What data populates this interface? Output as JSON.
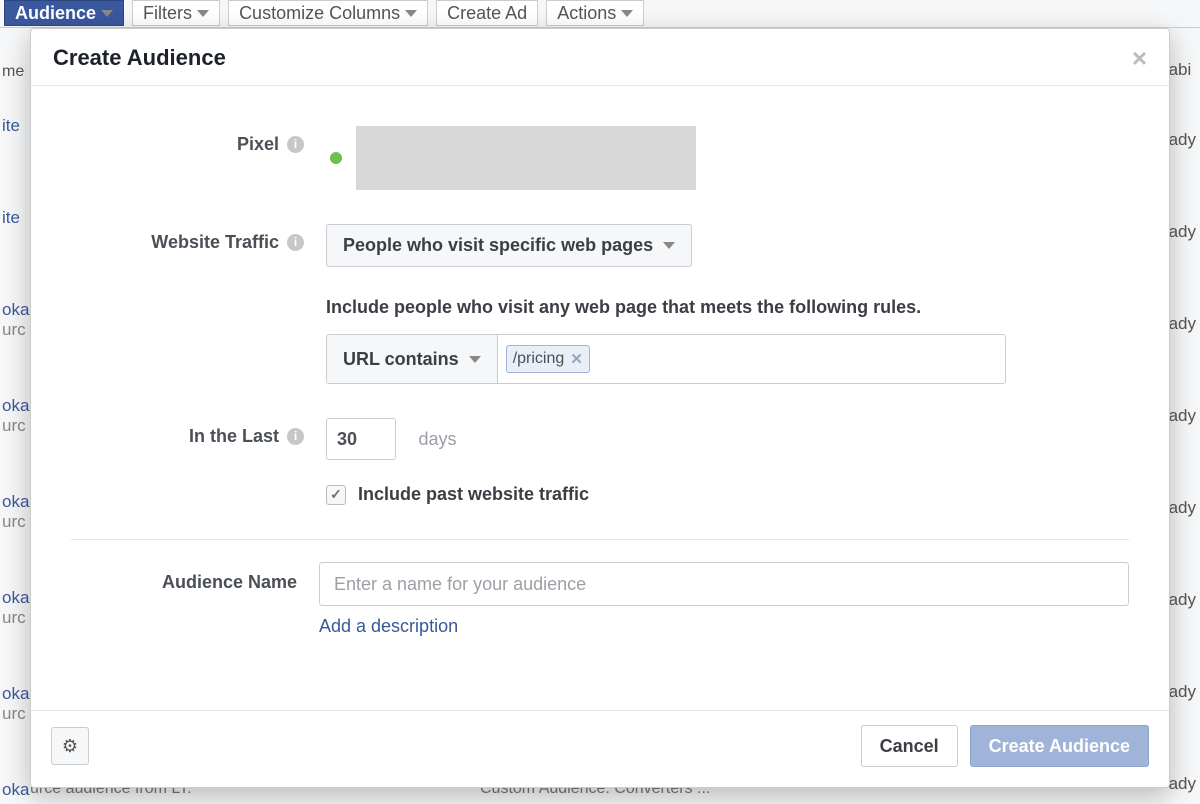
{
  "bg": {
    "audience_btn": "Audience",
    "filters_btn": "Filters",
    "customize_btn": "Customize Columns",
    "create_ad_btn": "Create Ad",
    "actions_btn": "Actions",
    "col_me": "me",
    "site": "ite",
    "oka": "oka",
    "urc": "urc",
    "abi": "abi",
    "ady": "ady",
    "bottom1": "urce audience from LT.",
    "bottom2": "Custom Audience: Converters ..."
  },
  "modal": {
    "title": "Create Audience",
    "labels": {
      "pixel": "Pixel",
      "website_traffic": "Website Traffic",
      "in_the_last": "In the Last",
      "audience_name": "Audience Name"
    },
    "website_traffic_select": "People who visit specific web pages",
    "rules_text": "Include people who visit any web page that meets the following rules.",
    "url_rule_select": "URL contains",
    "url_token": "/pricing",
    "days_value": "30",
    "days_label": "days",
    "include_past_label": "Include past website traffic",
    "include_past_checked": true,
    "name_placeholder": "Enter a name for your audience",
    "add_description": "Add a description",
    "footer": {
      "cancel": "Cancel",
      "create": "Create Audience"
    }
  }
}
